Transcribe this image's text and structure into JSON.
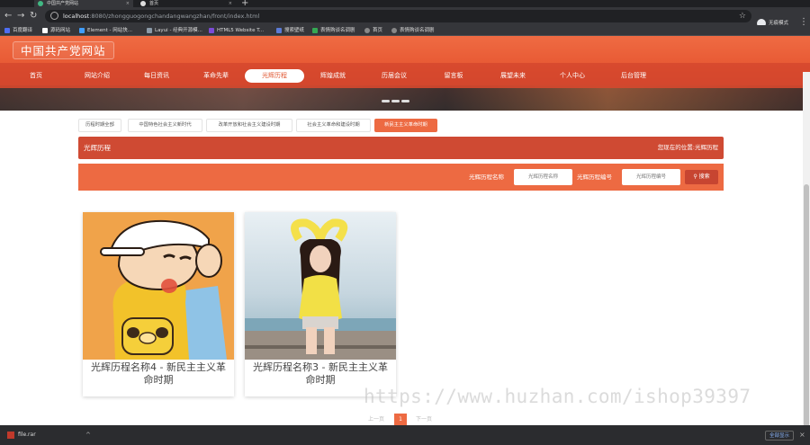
{
  "browser": {
    "tabs": [
      {
        "label": "中国共产党网站",
        "color": "#41b883"
      },
      {
        "label": "首页",
        "color": "#dddddd"
      }
    ],
    "url_host": "localhost",
    "url_path": ":8080/zhongguogongchandangwangzhan/front/index.html",
    "profile": "无痕模式",
    "bookmarks": [
      {
        "label": "百度翻译",
        "color": "#4e6ef2"
      },
      {
        "label": "源码网站",
        "color": "#ffffff"
      },
      {
        "label": "Element - 网站快...",
        "color": "#409eff"
      },
      {
        "label": "Layui - 经典开源模...",
        "color": "#2f3b46"
      },
      {
        "label": "HTML5 Website T...",
        "color": "#7b4bd6"
      },
      {
        "label": "搜索壁纸",
        "color": "#5b7bd5"
      },
      {
        "label": "表情购谈名调剧",
        "color": "#34a853"
      },
      {
        "label": "首页",
        "color": "#888888"
      },
      {
        "label": "表情购谈名调剧",
        "color": "#888888"
      }
    ]
  },
  "site": {
    "logo": "中国共产党网站",
    "nav": [
      "首页",
      "网站介绍",
      "每日资讯",
      "革命先辈",
      "光辉历程",
      "辉煌成就",
      "历届会议",
      "留言板",
      "展望未来",
      "个人中心",
      "后台管理"
    ],
    "nav_active": "光辉历程"
  },
  "categories": [
    "历程时期全部",
    "中国特色社会主义新时代",
    "改革开放和社会主义建设时期",
    "社会主义革命和建设时期",
    "新民主主义革命时期"
  ],
  "category_active": "新民主主义革命时期",
  "section": {
    "title": "光辉历程",
    "location_label": "您现在的位置:",
    "location_value": "光辉历程"
  },
  "search": {
    "name_label": "光辉历程名称",
    "name_placeholder": "光辉历程名称",
    "code_label": "光辉历程编号",
    "code_placeholder": "光辉历程编号",
    "button": "搜索"
  },
  "cards": [
    {
      "title": "光辉历程名称4 - 新民主主义革命时期"
    },
    {
      "title": "光辉历程名称3 - 新民主主义革命时期"
    }
  ],
  "pagination": {
    "prev": "上一页",
    "current": "1",
    "next": "下一页"
  },
  "watermark": "https://www.huzhan.com/ishop39397",
  "downloads": {
    "file": "file.rar",
    "show_all": "全部显示"
  },
  "colors": {
    "brand": "#ed6a42",
    "brand_dark": "#cf4a33"
  }
}
